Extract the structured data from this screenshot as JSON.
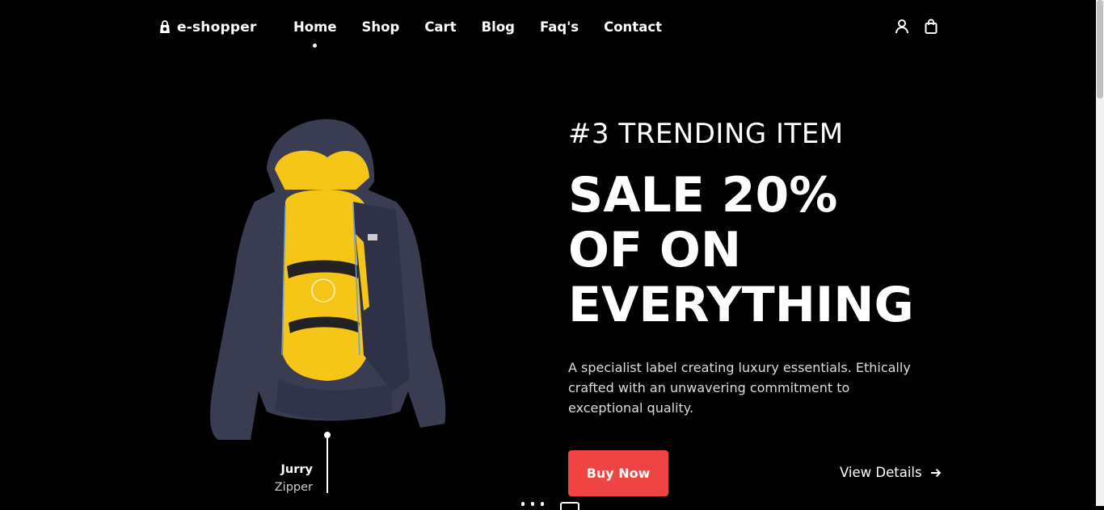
{
  "header": {
    "logo_text": "e-shopper",
    "nav": [
      {
        "label": "Home",
        "active": true
      },
      {
        "label": "Shop"
      },
      {
        "label": "Cart"
      },
      {
        "label": "Blog"
      },
      {
        "label": "Faq's"
      },
      {
        "label": "Contact"
      }
    ],
    "icons": [
      "user-icon",
      "shopping-bag-icon"
    ]
  },
  "hero": {
    "tagline": "#3 TRENDING ITEM",
    "headline": [
      "SALE 20%",
      "OF ON",
      "EVERYTHING"
    ],
    "description": "A specialist label creating luxury essentials. Ethically crafted with an unwavering commitment to exceptional quality.",
    "buy_button": "Buy Now",
    "view_details": "View Details",
    "product_pin": {
      "name": "Jurry",
      "subtitle": "Zipper"
    }
  },
  "colors": {
    "background": "#000000",
    "accent": "#ef4444",
    "jacket_shell": "#3a3d52",
    "jacket_lining": "#f5c518"
  }
}
